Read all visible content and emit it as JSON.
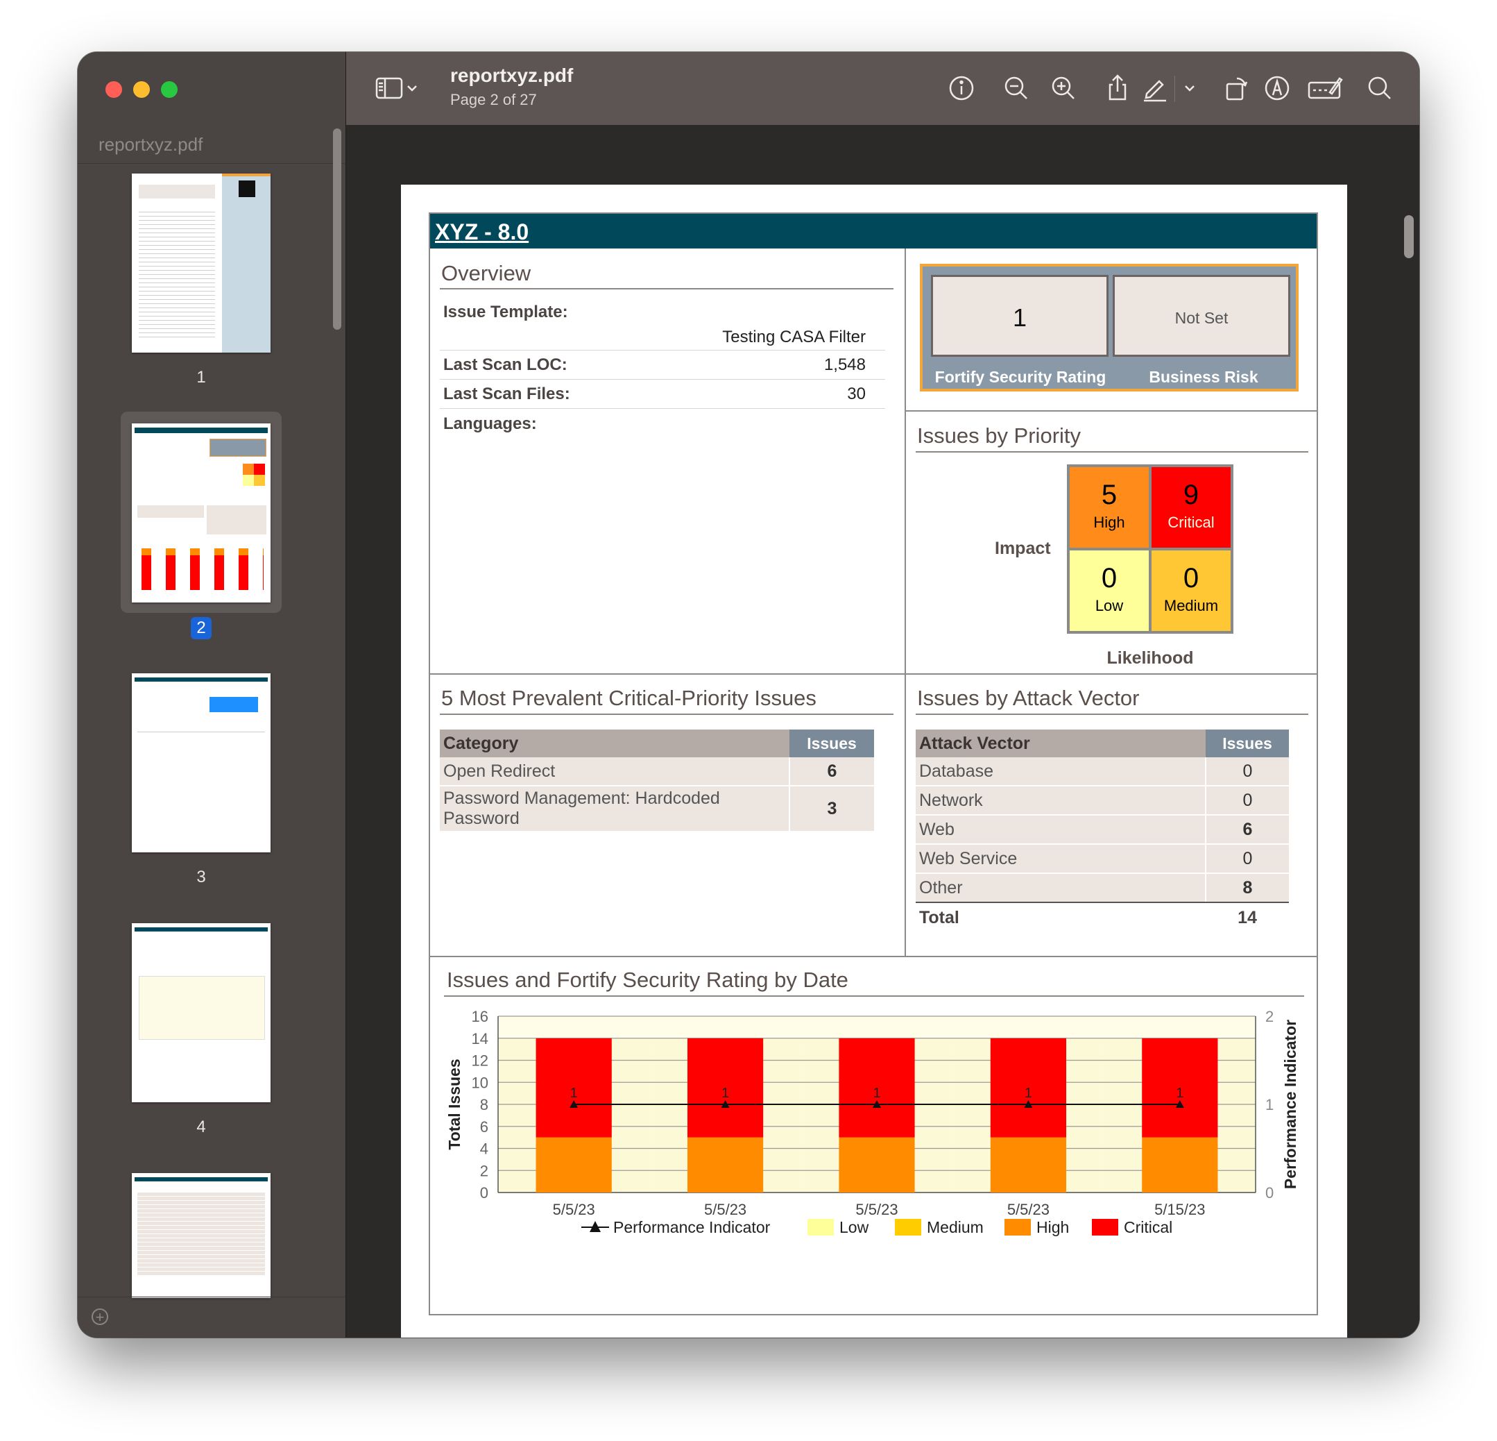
{
  "sidebar": {
    "title": "reportxyz.pdf",
    "pages": [
      "1",
      "2",
      "3",
      "4"
    ],
    "selected_page": "2"
  },
  "toolbar": {
    "doc_title": "reportxyz.pdf",
    "page_indicator": "Page 2 of 27",
    "icons": [
      "sidebar-toggle-icon",
      "chevron-down-icon",
      "info-icon",
      "zoom-out-icon",
      "zoom-in-icon",
      "share-icon",
      "highlight-pen-icon",
      "chevron-down-icon",
      "rotate-icon",
      "markup-icon",
      "form-fill-icon",
      "search-icon"
    ]
  },
  "report": {
    "header": "XYZ - 8.0",
    "overview": {
      "title": "Overview",
      "issue_template_label": "Issue Template:",
      "issue_template_value": "Testing CASA Filter",
      "last_scan_loc_label": "Last Scan LOC:",
      "last_scan_loc_value": "1,548",
      "last_scan_files_label": "Last Scan Files:",
      "last_scan_files_value": "30",
      "languages_label": "Languages:"
    },
    "rating": {
      "fortify_value": "1",
      "fortify_label": "Fortify Security Rating",
      "business_value": "Not Set",
      "business_label": "Business Risk"
    },
    "priority": {
      "title": "Issues by Priority",
      "impact_label": "Impact",
      "likelihood_label": "Likelihood",
      "high": {
        "num": "5",
        "label": "High"
      },
      "critical": {
        "num": "9",
        "label": "Critical"
      },
      "low": {
        "num": "0",
        "label": "Low"
      },
      "medium": {
        "num": "0",
        "label": "Medium"
      },
      "colors": {
        "high": "#ff8c1a",
        "critical": "#ff0000",
        "low": "#ffff99",
        "medium": "#ffc733"
      }
    },
    "prevalent": {
      "title": "5 Most Prevalent Critical-Priority Issues",
      "col_category": "Category",
      "col_issues": "Issues",
      "rows": [
        {
          "category": "Open Redirect",
          "issues": "6"
        },
        {
          "category": "Password Management: Hardcoded Password",
          "issues": "3"
        }
      ]
    },
    "attack_vector": {
      "title": "Issues by Attack Vector",
      "col_vector": "Attack Vector",
      "col_issues": "Issues",
      "rows": [
        {
          "vector": "Database",
          "issues": "0"
        },
        {
          "vector": "Network",
          "issues": "0"
        },
        {
          "vector": "Web",
          "issues": "6"
        },
        {
          "vector": "Web Service",
          "issues": "0"
        },
        {
          "vector": "Other",
          "issues": "8"
        }
      ],
      "total_label": "Total",
      "total_value": "14"
    }
  },
  "chart_data": {
    "type": "bar",
    "title": "Issues and Fortify Security Rating by Date",
    "xlabel": "",
    "ylabel": "Total Issues",
    "y2label": "Performance Indicator",
    "categories": [
      "5/5/23",
      "5/5/23",
      "5/5/23",
      "5/5/23",
      "5/15/23"
    ],
    "ylim": [
      0,
      16
    ],
    "y2lim": [
      0,
      2
    ],
    "yticks": [
      0,
      2,
      4,
      6,
      8,
      10,
      12,
      14,
      16
    ],
    "y2ticks": [
      0,
      1,
      2
    ],
    "stacked": true,
    "series": [
      {
        "name": "Low",
        "values": [
          0,
          0,
          0,
          0,
          0
        ],
        "color": "#ffff99"
      },
      {
        "name": "Medium",
        "values": [
          0,
          0,
          0,
          0,
          0
        ],
        "color": "#ffcc00"
      },
      {
        "name": "High",
        "values": [
          5,
          5,
          5,
          5,
          5
        ],
        "color": "#ff8c00"
      },
      {
        "name": "Critical",
        "values": [
          9,
          9,
          9,
          9,
          9
        ],
        "color": "#ff0000"
      }
    ],
    "line_series": {
      "name": "Performance Indicator",
      "values": [
        1,
        1,
        1,
        1,
        1
      ],
      "axis": "right"
    },
    "legend": [
      "Performance Indicator",
      "Low",
      "Medium",
      "High",
      "Critical"
    ],
    "legend_position": "bottom",
    "grid": true
  }
}
